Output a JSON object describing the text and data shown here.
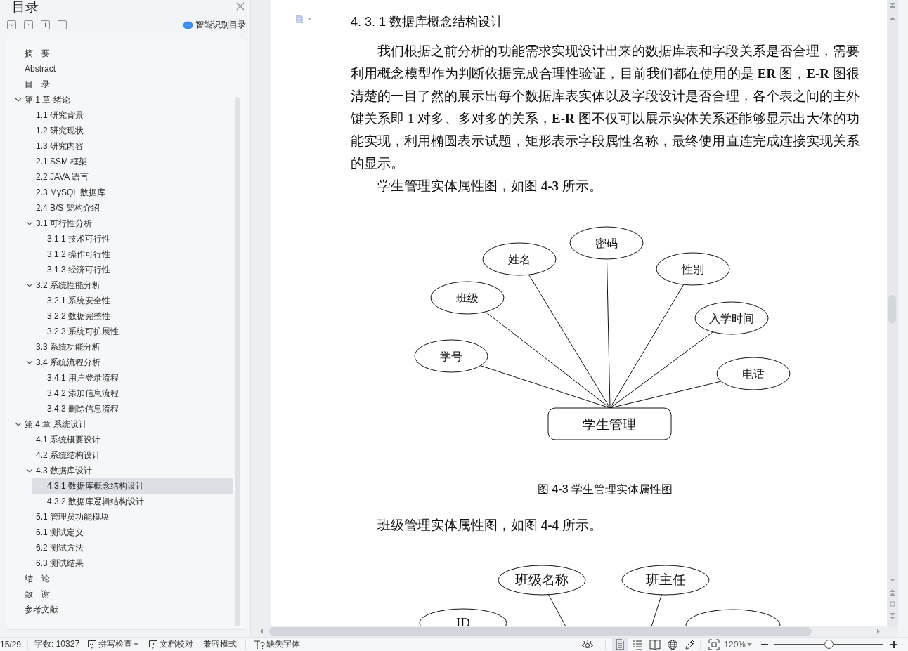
{
  "toc": {
    "title": "目录",
    "smart_button": "智能识别目录",
    "items": [
      {
        "label": "摘　要",
        "selected": false
      },
      {
        "label": "Abstract",
        "selected": false
      },
      {
        "label": "目　录",
        "selected": false
      },
      {
        "label": "第 1 章  绪论",
        "selected": false,
        "expanded": true,
        "children": [
          {
            "label": "1.1  研究背景",
            "selected": false
          },
          {
            "label": "1.2  研究现状",
            "selected": false
          },
          {
            "label": "1.3  研究内容",
            "selected": false
          },
          {
            "label": "2.1 SSM 框架",
            "selected": false
          },
          {
            "label": "2.2 JAVA 语言",
            "selected": false
          },
          {
            "label": "2.3 MySQL 数据库",
            "selected": false
          },
          {
            "label": "2.4   B/S 架构介绍",
            "selected": false
          },
          {
            "label": "3.1  可行性分析",
            "selected": false,
            "expanded": true,
            "children": [
              {
                "label": "3.1.1  技术可行性",
                "selected": false
              },
              {
                "label": "3.1.2  操作可行性",
                "selected": false
              },
              {
                "label": "3.1.3  经济可行性",
                "selected": false
              }
            ]
          },
          {
            "label": "3.2  系统性能分析",
            "selected": false,
            "expanded": true,
            "children": [
              {
                "label": "3.2.1  系统安全性",
                "selected": false
              },
              {
                "label": "3.2.2  数据完整性",
                "selected": false
              },
              {
                "label": "3.2.3  系统可扩展性",
                "selected": false
              }
            ]
          },
          {
            "label": "3.3  系统功能分析",
            "selected": false
          },
          {
            "label": "3.4  系统流程分析",
            "selected": false,
            "expanded": true,
            "children": [
              {
                "label": "3.4.1  用户登录流程",
                "selected": false
              },
              {
                "label": "3.4.2  添加信息流程",
                "selected": false
              },
              {
                "label": "3.4.3  删除信息流程",
                "selected": false
              }
            ]
          }
        ]
      },
      {
        "label": "第 4 章  系统设计",
        "selected": false,
        "expanded": true,
        "children": [
          {
            "label": "4.1  系统概要设计",
            "selected": false
          },
          {
            "label": "4.2  系统结构设计",
            "selected": false
          },
          {
            "label": "4.3  数据库设计",
            "selected": false,
            "expanded": true,
            "children": [
              {
                "label": "4.3.1 数据库概念结构设计",
                "selected": true
              },
              {
                "label": "4.3.2 数据库逻辑结构设计",
                "selected": false
              }
            ]
          },
          {
            "label": "5.1  管理员功能模块",
            "selected": false
          },
          {
            "label": "6.1  测试定义",
            "selected": false
          },
          {
            "label": "6.2  测试方法",
            "selected": false
          },
          {
            "label": "6.3  测试结果",
            "selected": false
          }
        ]
      },
      {
        "label": "结　论",
        "selected": false
      },
      {
        "label": "致　谢",
        "selected": false
      },
      {
        "label": "参考文献",
        "selected": false
      }
    ]
  },
  "document": {
    "blocks": [
      {
        "kind": "heading",
        "text": "4. 3. 1 数据库概念结构设计"
      },
      {
        "kind": "paragraph",
        "text": "我们根据之前分析的功能需求实现设计出来的数据库表和字段关系是否合理，需要利用概念模型作为判断依据完成合理性验证，目前我们都在使用的是 **ER** 图，**E-R** 图很清楚的一目了然的展示出每个数据库表实体以及字段设计是否合理，各个表之间的主外键关系即 1 对多、多对多的关系，**E-R** 图不仅可以展示实体关系还能够显示出大体的功能实现，利用椭圆表示试题，矩形表示字段属性名称，最终使用直连完成连接实现关系的显示。"
      },
      {
        "kind": "paragraph",
        "text": "学生管理实体属性图，如图 **4-3** 所示。"
      },
      {
        "kind": "page_break"
      },
      {
        "kind": "diagram",
        "entity": "学生管理",
        "attributes": [
          {
            "label": "姓名"
          },
          {
            "label": "密码"
          },
          {
            "label": "性别"
          },
          {
            "label": "班级"
          },
          {
            "label": "入学时间"
          },
          {
            "label": "学号"
          },
          {
            "label": "电话"
          }
        ]
      },
      {
        "kind": "caption",
        "text": "图 4-3 学生管理实体属性图"
      },
      {
        "kind": "paragraph",
        "text": "班级管理实体属性图，如图 **4-4** 所示。"
      },
      {
        "kind": "diagram_partial",
        "attributes": [
          {
            "label": "班级名称"
          },
          {
            "label": "班主任"
          },
          {
            "label": "ID"
          },
          {
            "kind": "unlabelled"
          }
        ]
      }
    ]
  },
  "status_bar": {
    "page": "15/29",
    "word_count": "字数: 10327",
    "spell_check": "拼写检查",
    "proofread": "文档校对",
    "compat_mode": "兼容模式",
    "missing_fonts": "缺失字体",
    "views": [
      {
        "selected": true
      },
      {
        "selected": false
      },
      {
        "selected": false
      },
      {
        "selected": false
      },
      {
        "selected": false
      }
    ],
    "zoom": "120%",
    "zoom_slider": {
      "level": 0.5
    }
  }
}
